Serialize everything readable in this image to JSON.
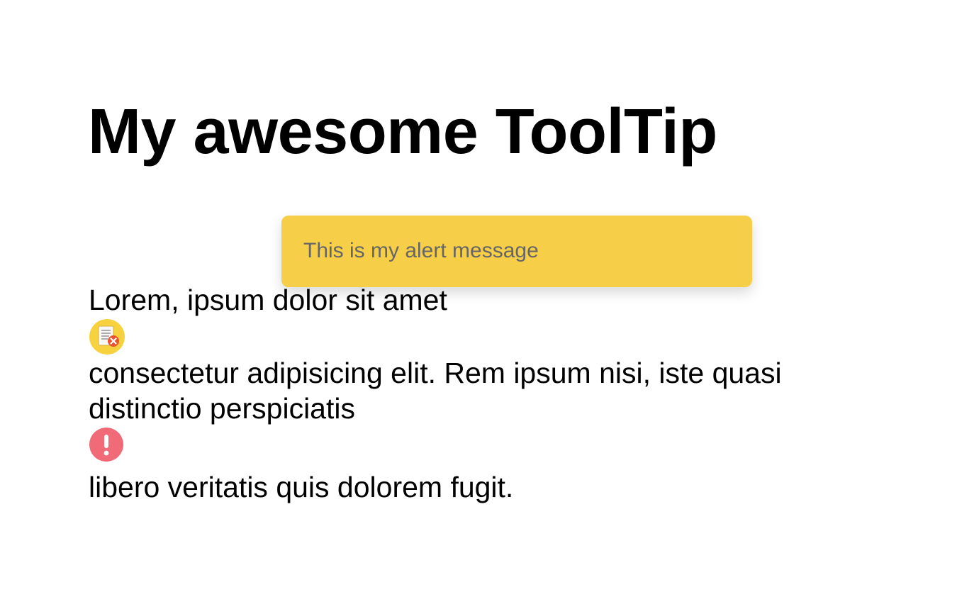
{
  "page": {
    "title": "My awesome ToolTip"
  },
  "content": {
    "line1": "Lorem, ipsum dolor sit amet",
    "line2": "consectetur adipisicing elit. Rem ipsum nisi, iste quasi distinctio perspiciatis",
    "line3": "libero veritatis quis dolorem fugit."
  },
  "icons": {
    "first": "document-error-icon",
    "second": "exclamation-icon"
  },
  "tooltip": {
    "message": "This is my alert message"
  },
  "colors": {
    "tooltip_background": "#f7ce48",
    "tooltip_text": "#666666",
    "doc_icon_circle": "#f7d23e",
    "doc_icon_badge": "#e8542f",
    "alert_icon_circle": "#f06a78"
  }
}
